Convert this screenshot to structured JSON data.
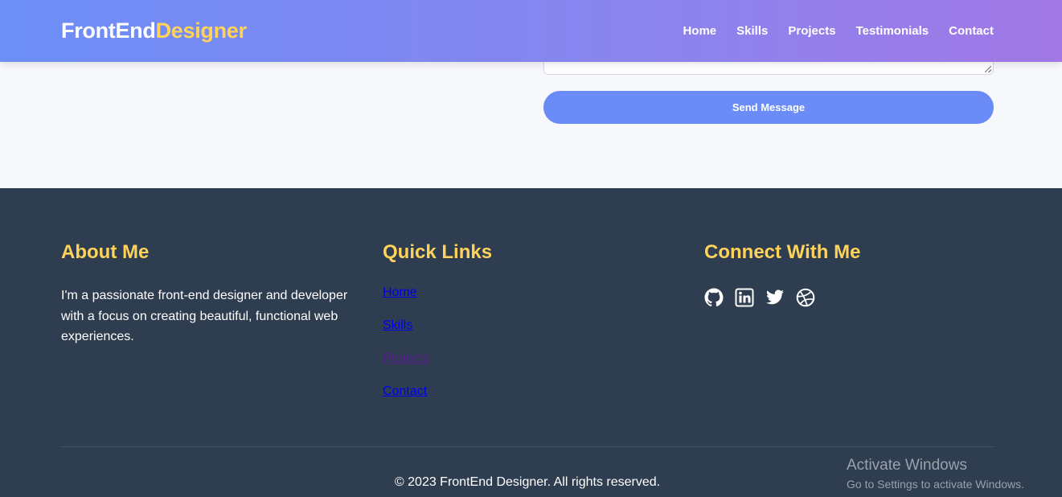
{
  "header": {
    "logo_part1": "FrontEnd",
    "logo_part2": "Designer",
    "nav": [
      "Home",
      "Skills",
      "Projects",
      "Testimonials",
      "Contact"
    ]
  },
  "contact": {
    "send_label": "Send Message"
  },
  "footer": {
    "about": {
      "title": "About Me",
      "text": "I'm a passionate front-end designer and developer with a focus on creating beautiful, functional web experiences."
    },
    "quick_links": {
      "title": "Quick Links",
      "links": [
        "Home",
        "Skills",
        "Projects",
        "Contact"
      ]
    },
    "connect": {
      "title": "Connect With Me",
      "icons": [
        "github-icon",
        "linkedin-icon",
        "twitter-icon",
        "dribbble-icon"
      ]
    },
    "copyright": "© 2023 FrontEnd Designer. All rights reserved."
  },
  "windows_watermark": {
    "title": "Activate Windows",
    "subtitle": "Go to Settings to activate Windows."
  },
  "colors": {
    "header_gradient_start": "#6c8ef7",
    "header_gradient_end": "#a178e6",
    "accent_yellow": "#ffd35a",
    "footer_bg": "#2e3d50",
    "button_bg": "#6b8cf6"
  }
}
